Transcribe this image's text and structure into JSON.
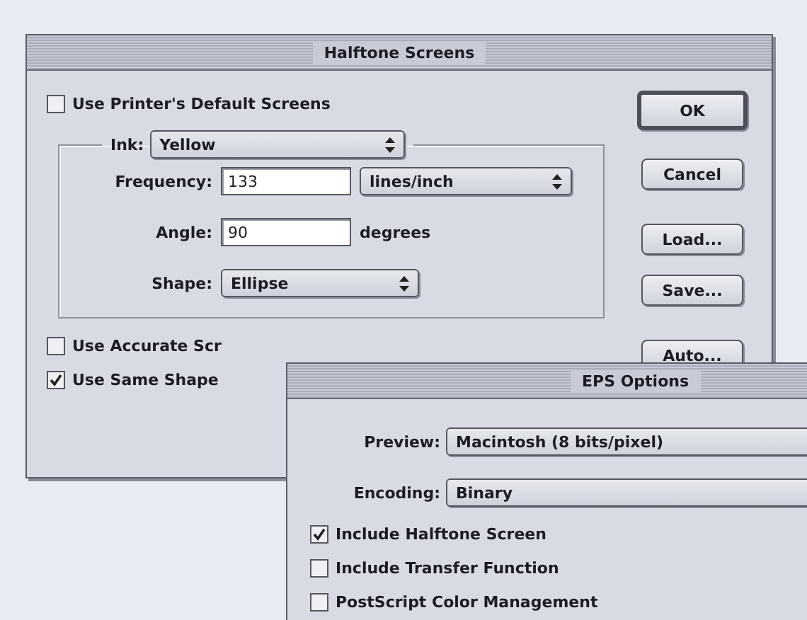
{
  "halftone_window": {
    "title": "Halftone Screens",
    "default_screens": {
      "label": "Use Printer's Default Screens",
      "checked": false
    },
    "ink": {
      "label": "Ink:",
      "value": "Yellow"
    },
    "fields": [
      {
        "label": "Frequency:",
        "value": "133",
        "unit": "lines/inch",
        "kind": "popup"
      },
      {
        "label": "Angle:",
        "value": "90",
        "unit": "degrees",
        "kind": "text"
      }
    ],
    "shape": {
      "label": "Shape:",
      "value": "Ellipse"
    },
    "options": [
      {
        "label": "Use Accurate Scr",
        "checked": false
      },
      {
        "label": "Use Same Shape",
        "checked": true
      }
    ],
    "buttons": [
      {
        "label": "OK",
        "default": true
      },
      {
        "label": "Cancel",
        "default": false
      },
      {
        "label": "Load...",
        "default": false
      },
      {
        "label": "Save...",
        "default": false
      },
      {
        "label": "Auto...",
        "default": false
      }
    ]
  },
  "eps_window": {
    "title": "EPS Options",
    "popups": [
      {
        "label": "Preview:",
        "value": "Macintosh  (8 bits/pixel)"
      },
      {
        "label": "Encoding:",
        "value": "Binary"
      }
    ],
    "options": [
      {
        "label": "Include Halftone Screen",
        "checked": true
      },
      {
        "label": "Include Transfer Function",
        "checked": false
      },
      {
        "label": "PostScript Color Management",
        "checked": false
      }
    ]
  }
}
